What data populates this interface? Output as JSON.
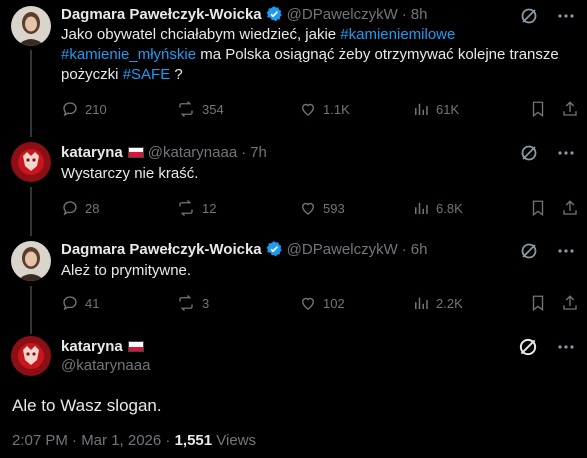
{
  "tweets": [
    {
      "name": "Dagmara Pawełczyk-Woicka",
      "handle": "@DPawelczykW",
      "time": "8h",
      "verified": true,
      "text_parts": [
        {
          "t": "Jako obywatel chciałabym wiedzieć,  jakie ",
          "h": false
        },
        {
          "t": "#kamieniemilowe",
          "h": true
        },
        {
          "t": "\n",
          "h": false
        },
        {
          "t": "#kamienie_młyńskie",
          "h": true
        },
        {
          "t": " ma Polska osiągnąć żeby  otrzymywać kolejne transze\npożyczki ",
          "h": false
        },
        {
          "t": "#SAFE",
          "h": true
        },
        {
          "t": " ?",
          "h": false
        }
      ],
      "replies": "210",
      "reposts": "354",
      "likes": "1.1K",
      "views": "61K"
    },
    {
      "name": "kataryna",
      "handle": "@katarynaaa",
      "time": "7h",
      "verified": false,
      "text": "Wystarczy nie kraść.",
      "replies": "28",
      "reposts": "12",
      "likes": "593",
      "views": "6.8K"
    },
    {
      "name": "Dagmara Pawełczyk-Woicka",
      "handle": "@DPawelczykW",
      "time": "6h",
      "verified": true,
      "text": "Ależ to prymitywne.",
      "replies": "41",
      "reposts": "3",
      "likes": "102",
      "views": "2.2K"
    }
  ],
  "main": {
    "name": "kataryna",
    "handle": "@katarynaaa",
    "text": "Ale to Wasz slogan.",
    "timestamp": "2:07 PM · Mar 1, 2026 · ",
    "views_count": "1,551",
    "views_label": " Views"
  },
  "colors": {
    "accent": "#1d9bf0",
    "muted": "#71767b",
    "text": "#e7e9ea",
    "divider": "#2f3336"
  }
}
